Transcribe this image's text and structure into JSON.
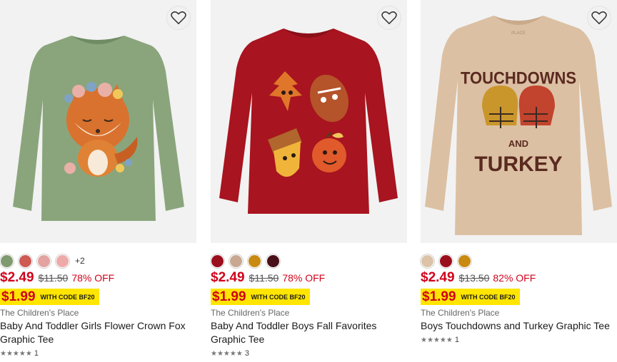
{
  "products": [
    {
      "image_alt": "Green long sleeve tee with fox flower crown graphic",
      "swatches": [
        "#7f9a6f",
        "#cd5a53",
        "#e3a3a0",
        "#eeaaa8"
      ],
      "more_swatches": "+2",
      "sale_price": "$2.49",
      "original_price": "$11.50",
      "discount": "78% OFF",
      "promo_price": "$1.99",
      "promo_code": "WITH CODE BF20",
      "brand": "The Children's Place",
      "title": "Baby And Toddler Girls Flower Crown Fox Graphic Tee",
      "rating_stars": "★★★★★",
      "rating_count": "1"
    },
    {
      "image_alt": "Red long sleeve tee with fall favorites graphic",
      "swatches": [
        "#9b0e1e",
        "#c8a892",
        "#c98a12",
        "#4a1018"
      ],
      "more_swatches": "",
      "sale_price": "$2.49",
      "original_price": "$11.50",
      "discount": "78% OFF",
      "promo_price": "$1.99",
      "promo_code": "WITH CODE BF20",
      "brand": "The Children's Place",
      "title": "Baby And Toddler Boys Fall Favorites Graphic Tee",
      "rating_stars": "★★★★★",
      "rating_count": "3"
    },
    {
      "image_alt": "Tan long sleeve tee with Touchdowns and Turkey graphic",
      "swatches": [
        "#dcc3a8",
        "#9b0e1e",
        "#c98a12"
      ],
      "more_swatches": "",
      "sale_price": "$2.49",
      "original_price": "$13.50",
      "discount": "82% OFF",
      "promo_price": "$1.99",
      "promo_code": "WITH CODE BF20",
      "brand": "The Children's Place",
      "title": "Boys Touchdowns and Turkey Graphic Tee",
      "rating_stars": "★★★★★",
      "rating_count": "1",
      "graphic_line1": "TOUCHDOWNS",
      "graphic_line2": "AND",
      "graphic_line3": "TURKEY"
    }
  ]
}
